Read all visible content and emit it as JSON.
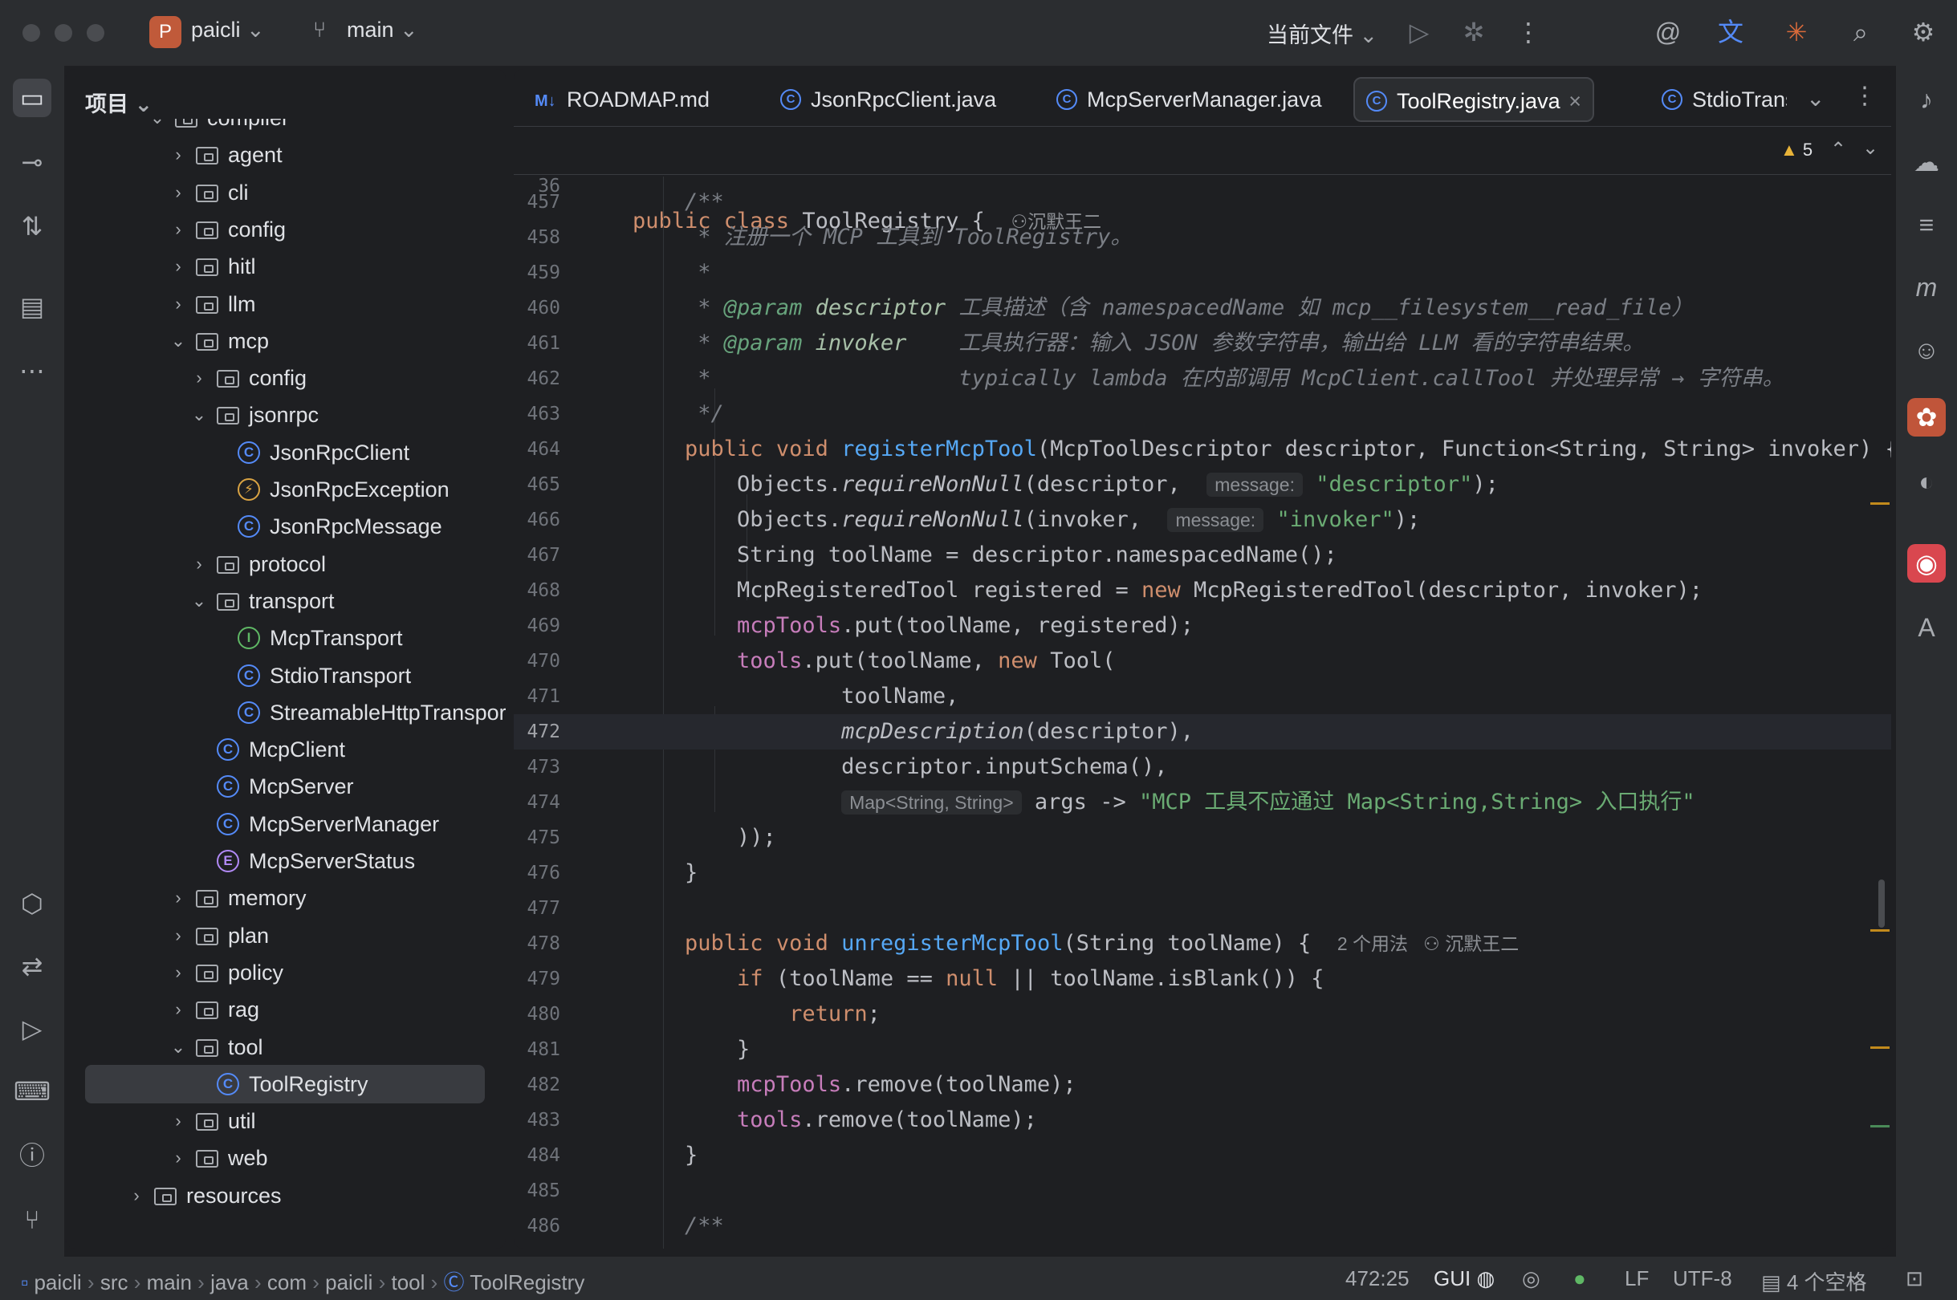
{
  "titlebar": {
    "project_initial": "P",
    "project_name": "paicli",
    "branch": "main",
    "run_config": "当前文件"
  },
  "project_panel": {
    "header": "项目",
    "items": [
      {
        "label": "compiler",
        "type": "folder",
        "expanded": true,
        "depth": 0
      },
      {
        "label": "agent",
        "type": "folder",
        "depth": 1
      },
      {
        "label": "cli",
        "type": "folder",
        "depth": 1
      },
      {
        "label": "config",
        "type": "folder",
        "depth": 1
      },
      {
        "label": "hitl",
        "type": "folder",
        "depth": 1
      },
      {
        "label": "llm",
        "type": "folder",
        "depth": 1
      },
      {
        "label": "mcp",
        "type": "folder",
        "expanded": true,
        "depth": 1
      },
      {
        "label": "config",
        "type": "folder",
        "depth": 2
      },
      {
        "label": "jsonrpc",
        "type": "folder",
        "expanded": true,
        "depth": 2
      },
      {
        "label": "JsonRpcClient",
        "type": "class",
        "depth": 3
      },
      {
        "label": "JsonRpcException",
        "type": "exception",
        "depth": 3
      },
      {
        "label": "JsonRpcMessage",
        "type": "class",
        "depth": 3
      },
      {
        "label": "protocol",
        "type": "folder",
        "depth": 2
      },
      {
        "label": "transport",
        "type": "folder",
        "expanded": true,
        "depth": 2
      },
      {
        "label": "McpTransport",
        "type": "interface",
        "depth": 3
      },
      {
        "label": "StdioTransport",
        "type": "class",
        "depth": 3
      },
      {
        "label": "StreamableHttpTransport",
        "type": "class",
        "depth": 3
      },
      {
        "label": "McpClient",
        "type": "class",
        "depth": 2
      },
      {
        "label": "McpServer",
        "type": "class",
        "depth": 2
      },
      {
        "label": "McpServerManager",
        "type": "class",
        "depth": 2
      },
      {
        "label": "McpServerStatus",
        "type": "enum",
        "depth": 2
      },
      {
        "label": "memory",
        "type": "folder",
        "depth": 1
      },
      {
        "label": "plan",
        "type": "folder",
        "depth": 1
      },
      {
        "label": "policy",
        "type": "folder",
        "depth": 1
      },
      {
        "label": "rag",
        "type": "folder",
        "depth": 1
      },
      {
        "label": "tool",
        "type": "folder",
        "expanded": true,
        "depth": 1
      },
      {
        "label": "ToolRegistry",
        "type": "class",
        "depth": 2,
        "selected": true
      },
      {
        "label": "util",
        "type": "folder",
        "depth": 1
      },
      {
        "label": "web",
        "type": "folder",
        "depth": 1
      },
      {
        "label": "resources",
        "type": "folder",
        "depth": -1
      }
    ]
  },
  "tabs": [
    {
      "label": "ROADMAP.md",
      "icon": "markdown-icon"
    },
    {
      "label": "JsonRpcClient.java",
      "icon": "class-icon"
    },
    {
      "label": "McpServerManager.java",
      "icon": "class-icon"
    },
    {
      "label": "ToolRegistry.java",
      "icon": "class-icon",
      "active": true
    },
    {
      "label": "StdioTransp",
      "icon": "class-icon"
    }
  ],
  "sticky": {
    "line": "36",
    "code_kw": "public class",
    "code_name": " ToolRegistry {",
    "author": "沉默王二",
    "warnings": "5"
  },
  "code": {
    "first_line": "456",
    "lines": [
      {
        "n": "457",
        "html": "    <span class='cm'>/**</span>"
      },
      {
        "n": "458",
        "html": "<span class='cm'>     * 注册一个 MCP 工具到 ToolRegistry。</span>"
      },
      {
        "n": "459",
        "html": "<span class='cm'>     *</span>"
      },
      {
        "n": "460",
        "html": "<span class='cm'>     * </span><span class='tag'>@param</span><span class='cm'> </span><span class='it' style='color:#a8c0a8'>descriptor</span><span class='cm'> 工具描述（含 namespacedName 如 mcp__filesystem__read_file）</span>"
      },
      {
        "n": "461",
        "html": "<span class='cm'>     * </span><span class='tag'>@param</span><span class='cm'> </span><span class='it' style='color:#a8c0a8'>invoker</span><span class='cm'>    工具执行器：输入 JSON 参数字符串，输出给 LLM 看的字符串结果。</span>"
      },
      {
        "n": "462",
        "html": "<span class='cm'>     *                   typically lambda 在内部调用 McpClient.callTool 并处理异常 → 字符串。</span>"
      },
      {
        "n": "463",
        "html": "<span class='cm'>     */</span>"
      },
      {
        "n": "464",
        "html": "    <span class='kw'>public void</span> <span class='fn'>registerMcpTool</span>(McpToolDescriptor descriptor, Function&lt;String, String&gt; invoker) {  <span class='hint-plain'>6 个用法</span>"
      },
      {
        "n": "465",
        "html": "        Objects.<span class='it'>requireNonNull</span>(descriptor,  <span class='hint'>message:</span> <span class='str'>\"descriptor\"</span>);"
      },
      {
        "n": "466",
        "html": "        Objects.<span class='it'>requireNonNull</span>(invoker,  <span class='hint'>message:</span> <span class='str'>\"invoker\"</span>);"
      },
      {
        "n": "467",
        "html": "        String toolName = descriptor.namespacedName();"
      },
      {
        "n": "468",
        "html": "        McpRegisteredTool registered = <span class='kw'>new</span> McpRegisteredTool(descriptor, invoker);"
      },
      {
        "n": "469",
        "html": "        <span class='fld'>mcpTools</span>.put(toolName, registered);"
      },
      {
        "n": "470",
        "html": "        <span class='fld'>tools</span>.put(toolName, <span class='kw'>new</span> Tool("
      },
      {
        "n": "471",
        "html": "                toolName,"
      },
      {
        "n": "472",
        "html": "                <span class='it'>mcpDescription</span>(descriptor),",
        "current": true
      },
      {
        "n": "473",
        "html": "                descriptor.inputSchema(),"
      },
      {
        "n": "474",
        "html": "                <span class='hint'>Map&lt;String, String&gt;</span> args -&gt; <span class='str'>\"MCP 工具不应通过 Map&lt;String,String&gt; 入口执行\"</span>"
      },
      {
        "n": "475",
        "html": "        ));"
      },
      {
        "n": "476",
        "html": "    }"
      },
      {
        "n": "477",
        "html": ""
      },
      {
        "n": "478",
        "html": "    <span class='kw'>public void</span> <span class='fn'>unregisterMcpTool</span>(String toolName) {  <span class='hint-plain'>2 个用法   ⚇ 沉默王二</span>"
      },
      {
        "n": "479",
        "html": "        <span class='kw'>if</span> (toolName == <span class='kw'>null</span> || toolName.isBlank()) {"
      },
      {
        "n": "480",
        "html": "            <span class='kw'>return</span>;"
      },
      {
        "n": "481",
        "html": "        }"
      },
      {
        "n": "482",
        "html": "        <span class='fld'>mcpTools</span>.remove(toolName);"
      },
      {
        "n": "483",
        "html": "        <span class='fld'>tools</span>.remove(toolName);"
      },
      {
        "n": "484",
        "html": "    }"
      },
      {
        "n": "485",
        "html": ""
      },
      {
        "n": "486",
        "html": "    <span class='cm'>/**</span>"
      }
    ]
  },
  "statusbar": {
    "breadcrumbs": [
      "paicli",
      "src",
      "main",
      "java",
      "com",
      "paicli",
      "tool",
      "ToolRegistry"
    ],
    "position": "472:25",
    "gui": "GUI",
    "line_sep": "LF",
    "encoding": "UTF-8",
    "indent": "4 个空格"
  },
  "colors": {
    "background": "#1e1f22",
    "panel": "#2b2d30",
    "accent": "#548af7",
    "keyword": "#cf8e6d",
    "string": "#6aab73",
    "function": "#56a8f5",
    "field": "#c77dbb"
  }
}
